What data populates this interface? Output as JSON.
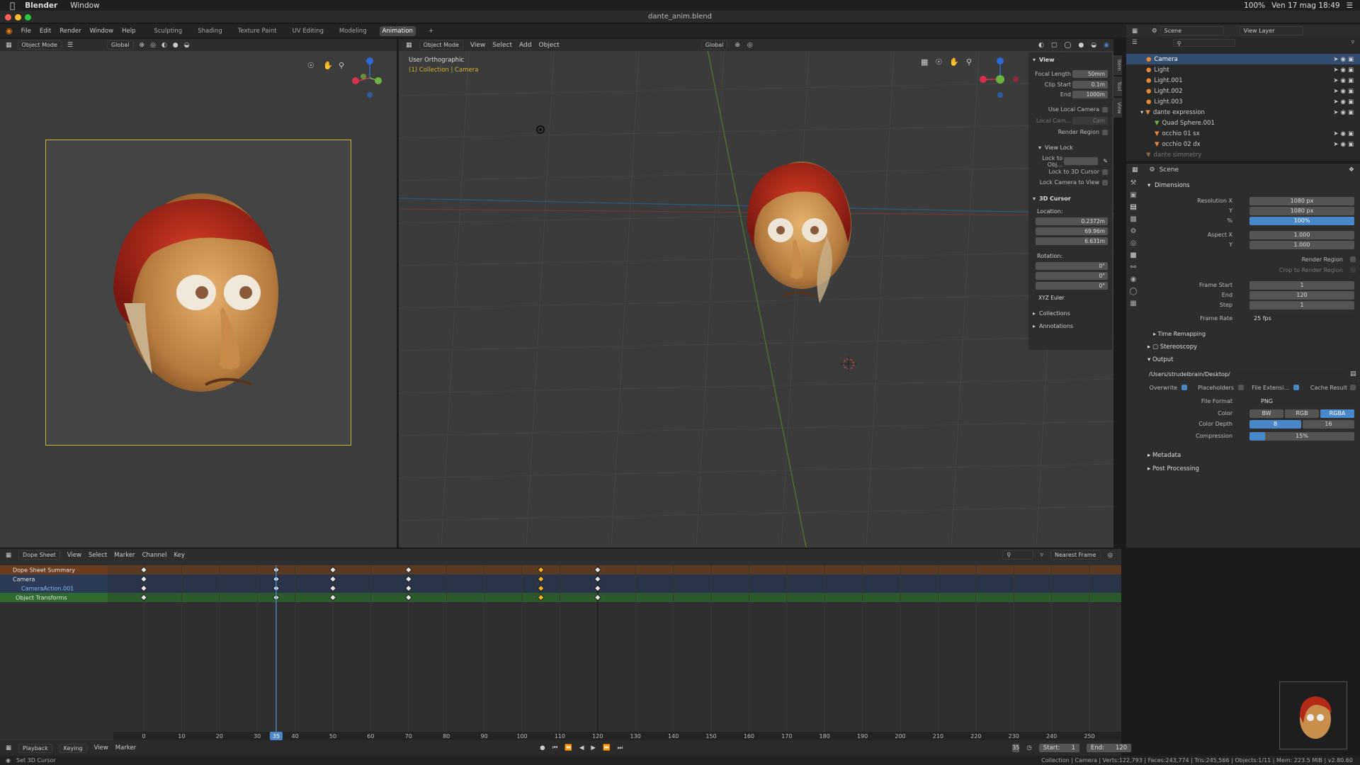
{
  "mac": {
    "app": "Blender",
    "menu": "Window",
    "right_items": [
      "100%",
      "Ven 17 mag 18:49"
    ]
  },
  "window": {
    "title": "dante_anim.blend"
  },
  "menus": [
    "File",
    "Edit",
    "Render",
    "Window",
    "Help"
  ],
  "workspaces": [
    "Sculpting",
    "Shading",
    "Texture Paint",
    "UV Editing",
    "Modeling",
    "Animation"
  ],
  "active_workspace": "Animation",
  "left_header": {
    "mode": "Object Mode",
    "orientation": "Global"
  },
  "viewport": {
    "header_mode": "Object Mode",
    "menus": [
      "View",
      "Select",
      "Add",
      "Object"
    ],
    "orientation": "Global",
    "view_label": "User Orthographic",
    "collection_label": "(1) Collection | Camera"
  },
  "npanel": {
    "view_section": "View",
    "focal_length_label": "Focal Length",
    "focal_length": "50mm",
    "clip_start_label": "Clip Start",
    "clip_start": "0.1m",
    "end_label": "End",
    "clip_end": "1000m",
    "use_local_camera": "Use Local Camera",
    "local_cam_label": "Local Cam...",
    "local_cam_value": "Cam",
    "render_region": "Render Region",
    "view_lock": "View Lock",
    "lock_obj": "Lock to Obj...",
    "lock_3d_cursor": "Lock to 3D Cursor",
    "lock_camera": "Lock Camera to View",
    "cursor_section": "3D Cursor",
    "location_label": "Location:",
    "loc_x": "0.2372m",
    "loc_y": "69.96m",
    "loc_z": "6.631m",
    "rotation_label": "Rotation:",
    "rot_x": "0°",
    "rot_y": "0°",
    "rot_z": "0°",
    "rot_mode": "XYZ Euler",
    "collections": "Collections",
    "annotations": "Annotations",
    "tabs": [
      "Item",
      "Tool",
      "View"
    ]
  },
  "outliner": {
    "scene": "Scene",
    "view_layer": "View Layer",
    "items": [
      {
        "name": "Camera",
        "selected": true
      },
      {
        "name": "Light"
      },
      {
        "name": "Light.001"
      },
      {
        "name": "Light.002"
      },
      {
        "name": "Light.003"
      },
      {
        "name": "dante expression"
      },
      {
        "name": "Quad Sphere.001"
      },
      {
        "name": "occhio 01 sx"
      },
      {
        "name": "occhio 02 dx"
      },
      {
        "name": "dante simmetry"
      }
    ]
  },
  "props": {
    "scene": "Scene",
    "dimensions": "Dimensions",
    "res_x_label": "Resolution X",
    "res_x": "1080 px",
    "res_y_label": "Y",
    "res_y": "1080 px",
    "pct_label": "%",
    "pct": "100%",
    "aspect_x_label": "Aspect X",
    "aspect_x": "1.000",
    "aspect_y_label": "Y",
    "aspect_y": "1.000",
    "render_region": "Render Region",
    "crop": "Crop to Render Region",
    "frame_start_label": "Frame Start",
    "frame_start": "1",
    "end_label": "End",
    "frame_end": "120",
    "step_label": "Step",
    "step": "1",
    "frame_rate_label": "Frame Rate",
    "frame_rate": "25 fps",
    "time_remapping": "Time Remapping",
    "stereoscopy": "Stereoscopy",
    "output": "Output",
    "path": "/Users/strudelbrain/Desktop/",
    "overwrite": "Overwrite",
    "placeholders": "Placeholders",
    "file_ext": "File Extensi...",
    "cache": "Cache Result",
    "file_format_label": "File Format",
    "file_format": "PNG",
    "color_label": "Color",
    "color_opts": [
      "BW",
      "RGB",
      "RGBA"
    ],
    "depth_label": "Color Depth",
    "depth_opts": [
      "8",
      "16"
    ],
    "compression_label": "Compression",
    "compression": "15%",
    "metadata": "Metadata",
    "post": "Post Processing"
  },
  "dope": {
    "editor": "Dope Sheet",
    "menus": [
      "View",
      "Select",
      "Marker",
      "Channel",
      "Key"
    ],
    "snap": "Nearest Frame",
    "channels": [
      "Dope Sheet Summary",
      "Camera",
      "CameraAction.001",
      "Object Transforms"
    ],
    "keyframes": [
      0,
      35,
      50,
      70,
      105,
      120
    ],
    "selected_keys": [
      105
    ],
    "current_frame": 35,
    "ruler": [
      "0",
      "10",
      "20",
      "30",
      "40",
      "50",
      "60",
      "70",
      "80",
      "90",
      "100",
      "110",
      "120",
      "130",
      "140",
      "150",
      "160",
      "170",
      "180",
      "190",
      "200",
      "210",
      "220",
      "230",
      "240",
      "250"
    ],
    "current_label": "35"
  },
  "timeline": {
    "menus": [
      "Playback",
      "Keying",
      "View",
      "Marker"
    ],
    "frame": "35",
    "start_label": "Start:",
    "start": "1",
    "end_label": "End:",
    "end": "120"
  },
  "status": {
    "left": "Set 3D Cursor",
    "right": "Collection | Camera | Verts:122,793 | Faces:243,774 | Tris:245,566 | Objects:1/11 | Mem: 223.5 MiB | v2.80.60"
  }
}
